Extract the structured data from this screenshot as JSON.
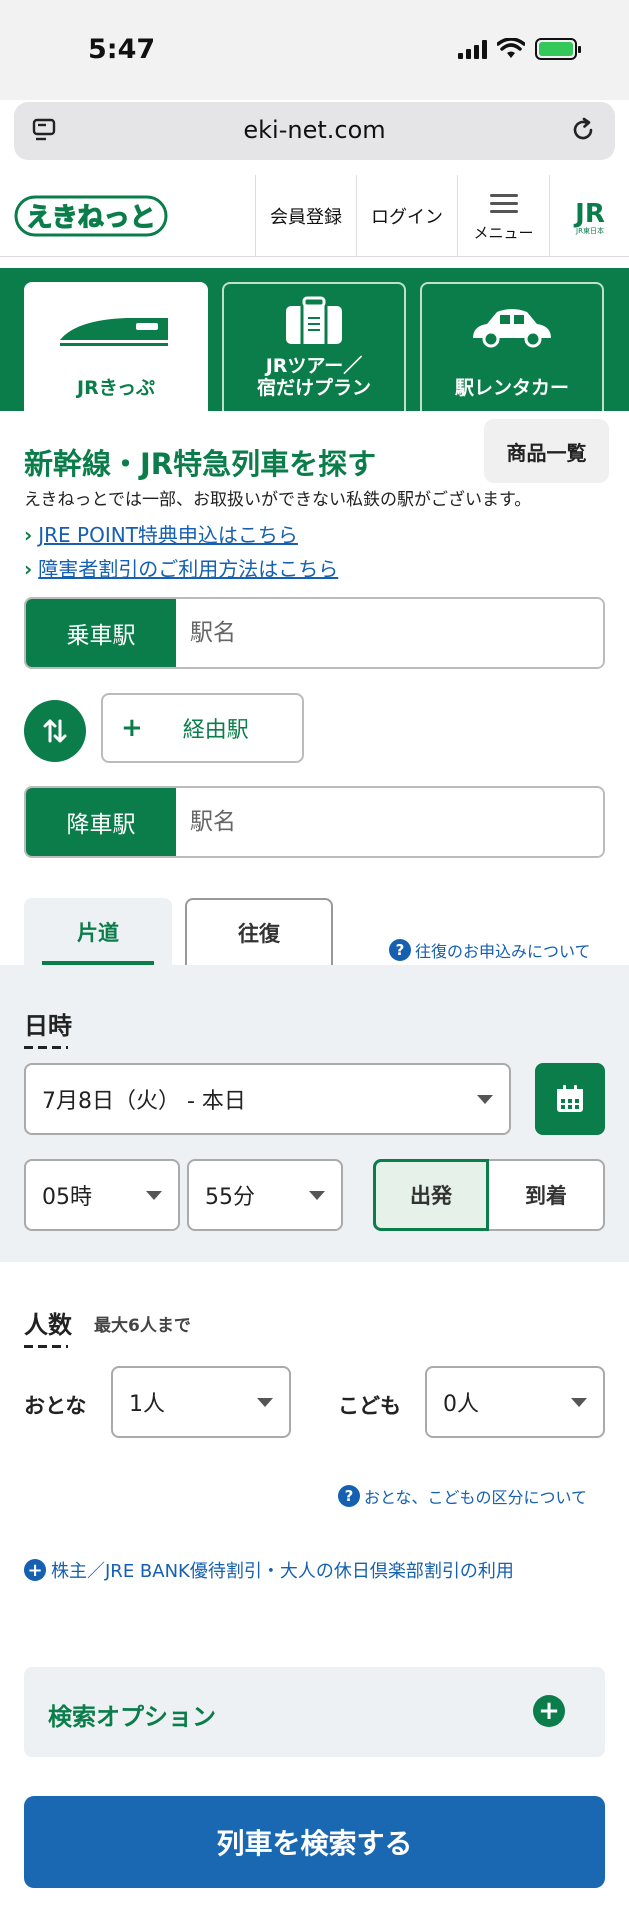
{
  "status": {
    "time": "5:47"
  },
  "browser": {
    "url": "eki-net.com"
  },
  "header": {
    "logo_text": "えきねっと",
    "register": "会員登録",
    "login": "ログイン",
    "menu": "メニュー",
    "jr_logo": "JR"
  },
  "product_tabs": [
    {
      "label": "JRきっぷ",
      "icon": "shinkansen-icon",
      "active": true
    },
    {
      "label_line1": "JRツアー／",
      "label_line2": "宿だけプラン",
      "icon": "suitcase-icon"
    },
    {
      "label": "駅レンタカー",
      "icon": "car-icon"
    }
  ],
  "search": {
    "title": "新幹線・JR特急列車を探す",
    "product_list": "商品一覧",
    "notice": "えきねっとでは一部、お取扱いができない私鉄の駅がございます。",
    "links": [
      "JRE POINT特典申込はこちら",
      "障害者割引のご利用方法はこちら"
    ],
    "departure_label": "乗車駅",
    "departure_placeholder": "駅名",
    "via_label": "経由駅",
    "arrival_label": "降車駅",
    "arrival_placeholder": "駅名",
    "swap_icon": "swap-arrows-icon"
  },
  "trip": {
    "one_way": "片道",
    "round_trip": "往復",
    "round_trip_help": "往復のお申込みについて"
  },
  "datetime": {
    "title": "日時",
    "date": "7月8日（火） - 本日",
    "hour": "05時",
    "minute": "55分",
    "depart": "出発",
    "arrive": "到着",
    "mode": "depart"
  },
  "people": {
    "title": "人数",
    "note": "最大6人まで",
    "adult_label": "おとな",
    "adult_value": "1人",
    "child_label": "こども",
    "child_value": "0人",
    "help": "おとな、こどもの区分について"
  },
  "discount_link": "株主／JRE BANK優待割引・大人の休日倶楽部割引の利用",
  "options_label": "検索オプション",
  "search_button": "列車を検索する",
  "colors": {
    "brand_green": "#0a7d4a",
    "link_blue": "#1560b0",
    "button_blue": "#1b68b2"
  }
}
